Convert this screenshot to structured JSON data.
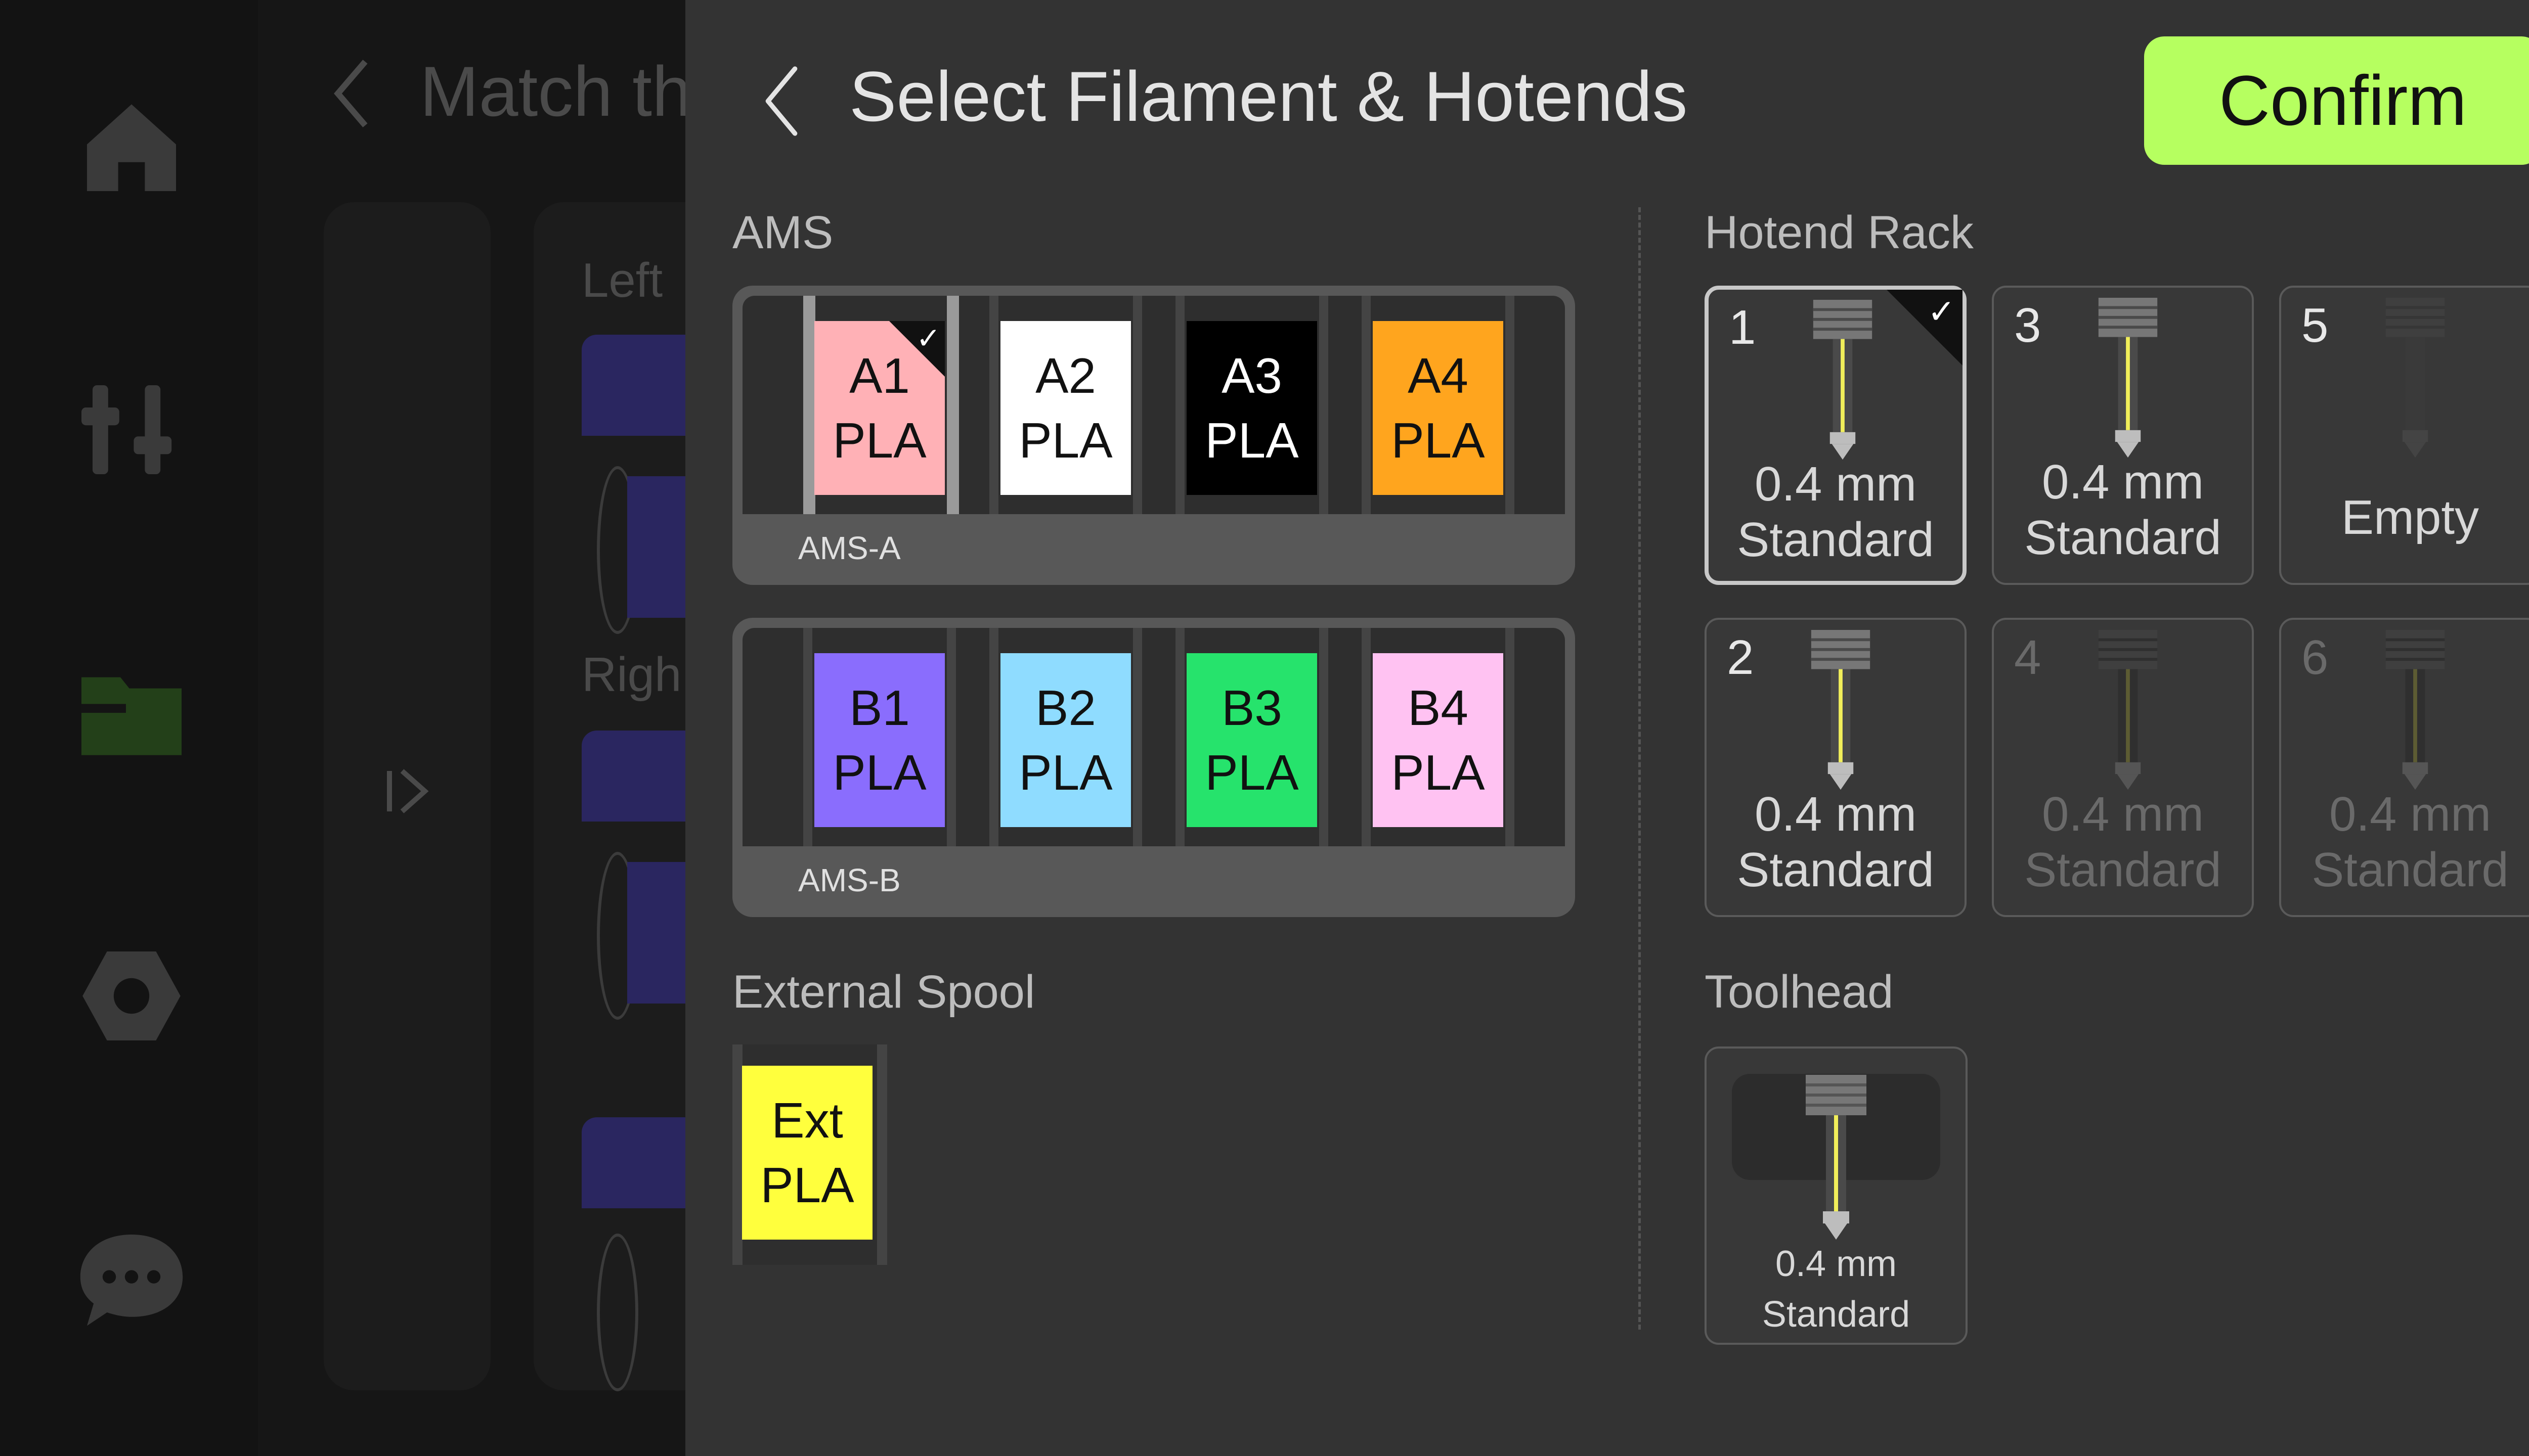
{
  "background": {
    "sidebar_icons": [
      "home-icon",
      "tune-icon",
      "folder-icon",
      "settings-hex-icon",
      "chat-icon"
    ],
    "page_title": "Match th",
    "left_label": "Left",
    "right_label": "Righ",
    "collapse_icon": "expand-panel-icon"
  },
  "modal": {
    "title": "Select Filament & Hotends",
    "back_icon": "chevron-left-icon",
    "confirm_label": "Confirm",
    "confirm_color": "#b6ff60",
    "ams_label": "AMS",
    "external_spool_label": "External Spool",
    "hotend_rack_label": "Hotend Rack",
    "toolhead_label": "Toolhead"
  },
  "ams_units": [
    {
      "name": "AMS-A",
      "slots": [
        {
          "id": "A1",
          "material": "PLA",
          "color": "#ffb1b6",
          "selected": true
        },
        {
          "id": "A2",
          "material": "PLA",
          "color": "#ffffff",
          "selected": false
        },
        {
          "id": "A3",
          "material": "PLA",
          "color": "#000000",
          "selected": false
        },
        {
          "id": "A4",
          "material": "PLA",
          "color": "#ffa51e",
          "selected": false
        }
      ]
    },
    {
      "name": "AMS-B",
      "slots": [
        {
          "id": "B1",
          "material": "PLA",
          "color": "#8a6dfd",
          "selected": false
        },
        {
          "id": "B2",
          "material": "PLA",
          "color": "#8fdcff",
          "selected": false
        },
        {
          "id": "B3",
          "material": "PLA",
          "color": "#26e36c",
          "selected": false
        },
        {
          "id": "B4",
          "material": "PLA",
          "color": "#ffc2f2",
          "selected": false
        }
      ]
    }
  ],
  "external_spool": {
    "id": "Ext",
    "material": "PLA",
    "color": "#ffff3d"
  },
  "hotend_rack": [
    {
      "number": "1",
      "size": "0.4 mm",
      "type": "Standard",
      "selected": true,
      "empty": false,
      "dim": false
    },
    {
      "number": "3",
      "size": "0.4 mm",
      "type": "Standard",
      "selected": false,
      "empty": false,
      "dim": false
    },
    {
      "number": "5",
      "size": "",
      "type": "Empty",
      "selected": false,
      "empty": true,
      "dim": false
    },
    {
      "number": "2",
      "size": "0.4 mm",
      "type": "Standard",
      "selected": false,
      "empty": false,
      "dim": false
    },
    {
      "number": "4",
      "size": "0.4 mm",
      "type": "Standard",
      "selected": false,
      "empty": false,
      "dim": true
    },
    {
      "number": "6",
      "size": "0.4 mm",
      "type": "Standard",
      "selected": false,
      "empty": false,
      "dim": true
    }
  ],
  "toolhead": {
    "size": "0.4 mm",
    "type": "Standard"
  }
}
